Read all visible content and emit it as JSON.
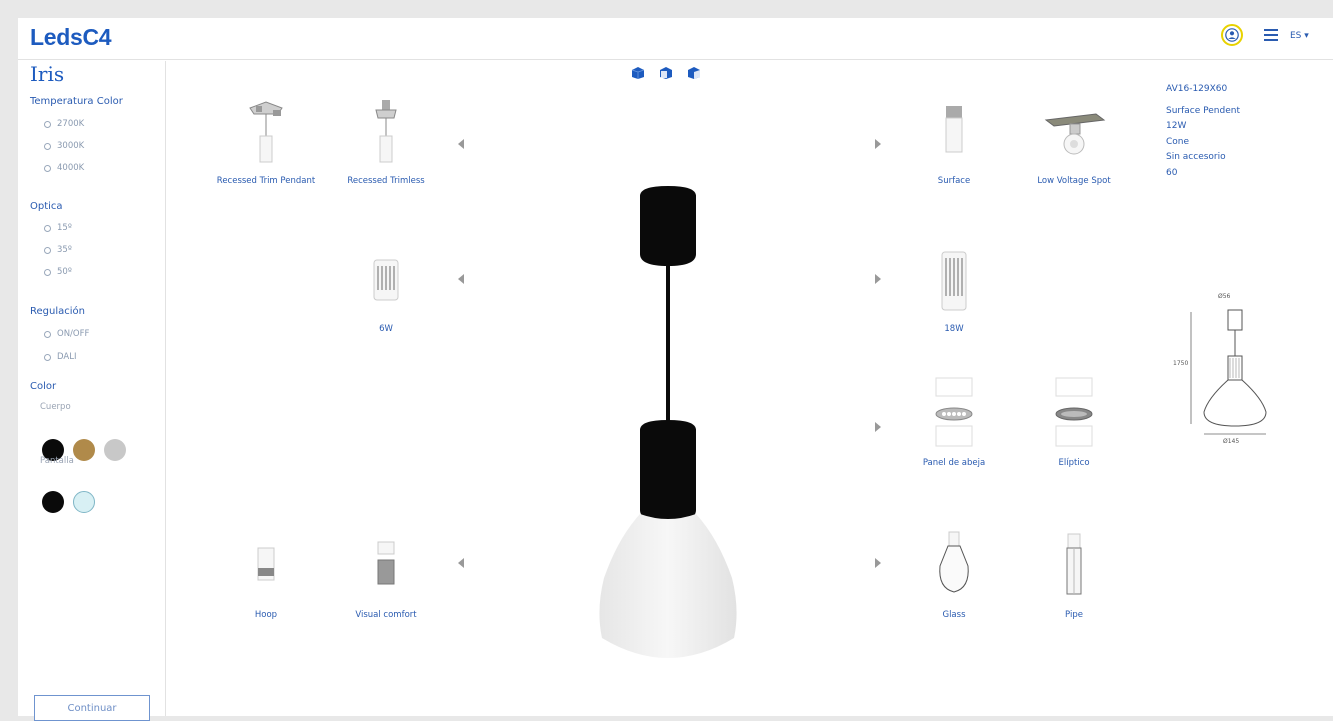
{
  "header": {
    "logo": "LedsC4",
    "lang": "ES ▾",
    "icons": [
      "user-icon",
      "menu-icon"
    ],
    "accent": "#1d5bbf"
  },
  "sidebar": {
    "product": "Iris",
    "temperatura": {
      "title": "Temperatura Color",
      "options": [
        "2700K",
        "3000K",
        "4000K"
      ]
    },
    "optica": {
      "title": "Optica",
      "options": [
        "15º",
        "35º",
        "50º"
      ]
    },
    "regulacion": {
      "title": "Regulación",
      "options": [
        "ON/OFF",
        "DALI"
      ]
    },
    "color": {
      "title": "Color",
      "cuerpo": "Cuerpo",
      "cuerpo_colors": [
        "#0a0a0a",
        "#b08a4a",
        "#c8c8c8"
      ],
      "pantalla": "Pantalla",
      "pantalla_colors": [
        "#0a0a0a",
        "#d8f0f4"
      ]
    },
    "continue": "Continuar"
  },
  "options": {
    "mount_left": [
      "Recessed Trim Pendant",
      "Recessed Trimless"
    ],
    "mount_right": [
      "Surface",
      "Low Voltage Spot"
    ],
    "power_left": "6W",
    "power_right": "18W",
    "accessory_right": [
      "Panel de abeja",
      "Elíptico"
    ],
    "shade_left": [
      "Hoop",
      "Visual comfort"
    ],
    "shade_right": [
      "Glass",
      "Pipe"
    ]
  },
  "spec": {
    "code": "AV16-129X60",
    "type": "Surface Pendent",
    "power": "12W",
    "shade": "Cone",
    "accessory": "Sin accesorio",
    "optic": "60"
  },
  "drawing": {
    "top_dim": "Ø56",
    "height": "1750",
    "bottom_dim": "Ø145"
  }
}
